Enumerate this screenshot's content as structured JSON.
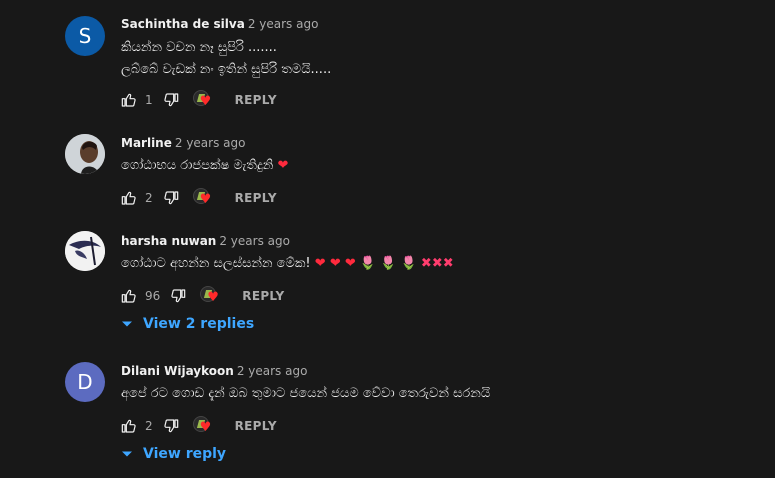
{
  "comments": [
    {
      "author": "Sachintha de silva",
      "time": "2 years ago",
      "avatar_letter": "S",
      "avatar_color": "#0b5aa6",
      "lines": [
        "කියන්න වචන නෑ සුපිරි .......",
        "ලබ්බේ වැඩක් නං ඉතින් සුපිරි තමයි....."
      ],
      "likes": "1",
      "reply_label": "REPLY"
    },
    {
      "author": "Marline",
      "time": "2 years ago",
      "avatar_color": "#d8d8d8",
      "lines": [
        "ගෝඨාභය රාජපක්ෂ මැතිදුනි"
      ],
      "trailing_emoji": "❤",
      "likes": "2",
      "reply_label": "REPLY"
    },
    {
      "author": "harsha nuwan",
      "time": "2 years ago",
      "avatar_color": "#eeeeee",
      "lines": [
        "ගෝඨාට අහන්න සලස්සන්න මේක!"
      ],
      "emojis": [
        "❤",
        "❤",
        "❤",
        "🌷",
        "🌷",
        "🌷",
        "✖",
        "✖",
        "✖"
      ],
      "likes": "96",
      "reply_label": "REPLY",
      "view_replies": "View 2 replies"
    },
    {
      "author": "Dilani Wijaykoon",
      "time": "2 years ago",
      "avatar_letter": "D",
      "avatar_color": "#5c6bc0",
      "lines": [
        "අපේ රට ගොඩ  දැන්  ඔබ තුමාට ජයෙන් ජයම වේවා  තෙරුවන් සරනයි"
      ],
      "likes": "2",
      "reply_label": "REPLY",
      "view_replies": "View reply"
    }
  ],
  "icons": {
    "like": "thumbs-up-icon",
    "dislike": "thumbs-down-icon",
    "creator_heart": "creator-heart-icon",
    "chevron": "chevron-down-icon"
  },
  "colors": {
    "background": "#181818",
    "link": "#3ea6ff",
    "secondary_text": "#aaaaaa",
    "heart": "#ff2a2a"
  }
}
